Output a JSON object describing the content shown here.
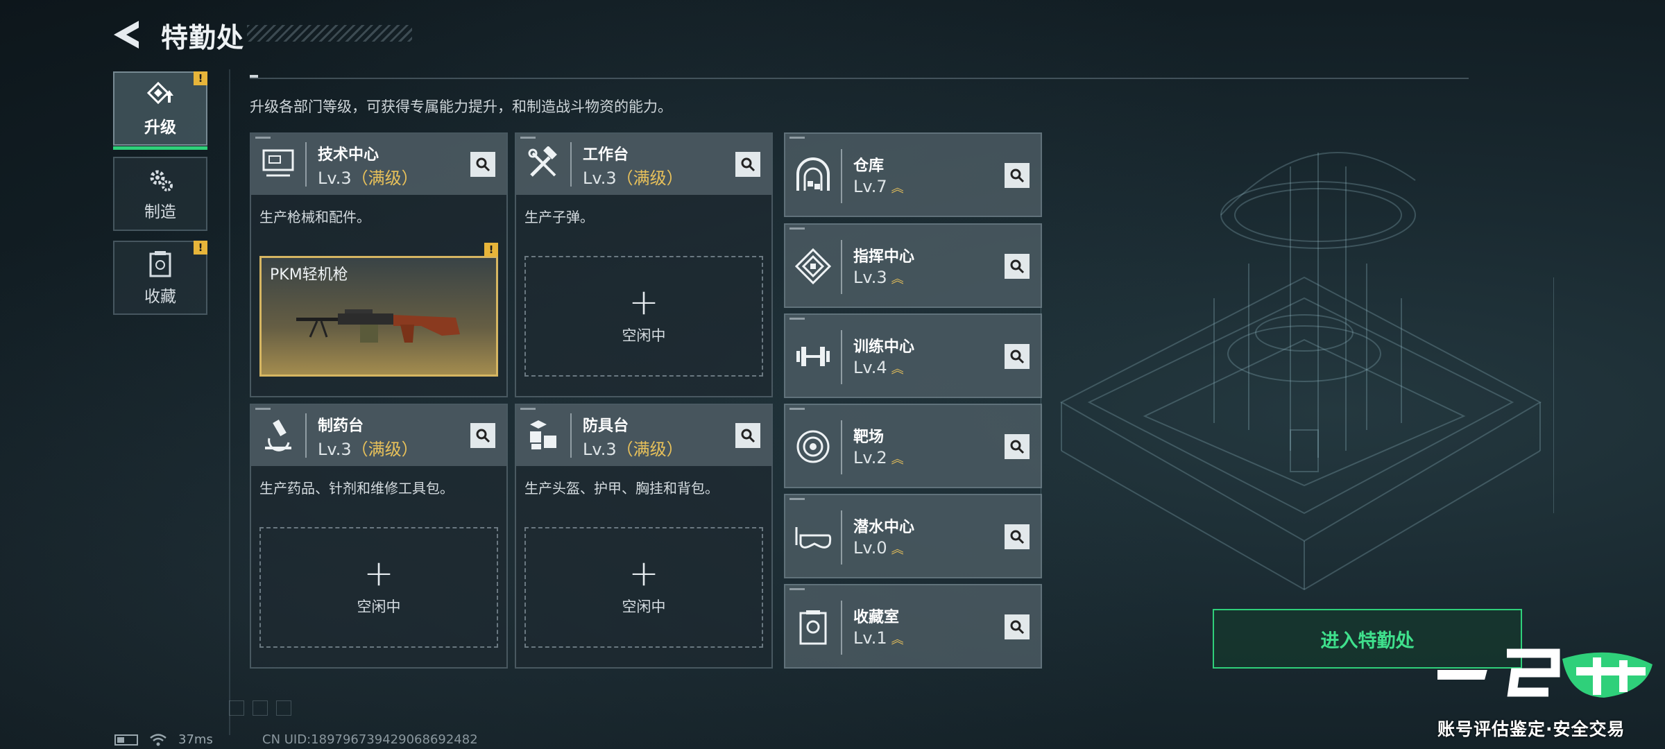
{
  "header": {
    "title": "特勤处"
  },
  "tabs": [
    {
      "label": "升级",
      "icon": "upgrade-icon",
      "active": true,
      "warning": "!"
    },
    {
      "label": "制造",
      "icon": "gears-icon",
      "active": false
    },
    {
      "label": "收藏",
      "icon": "collection-icon",
      "active": false,
      "warning": "!"
    }
  ],
  "description": "升级各部门等级，可获得专属能力提升，和制造战斗物资的能力。",
  "departments": [
    {
      "name": "技术中心",
      "level": "Lv.3",
      "max": "（满级）",
      "desc": "生产枪械和配件。",
      "slot": {
        "item": "PKM轻机枪",
        "warning": "!"
      }
    },
    {
      "name": "工作台",
      "level": "Lv.3",
      "max": "（满级）",
      "desc": "生产子弹。",
      "slot": {
        "plus": "+",
        "idle": "空闲中"
      }
    },
    {
      "name": "制药台",
      "level": "Lv.3",
      "max": "（满级）",
      "desc": "生产药品、针剂和维修工具包。",
      "slot": {
        "plus": "+",
        "idle": "空闲中"
      }
    },
    {
      "name": "防具台",
      "level": "Lv.3",
      "max": "（满级）",
      "desc": "生产头盔、护甲、胸挂和背包。",
      "slot": {
        "plus": "+",
        "idle": "空闲中"
      }
    }
  ],
  "facilities": [
    {
      "name": "仓库",
      "level": "Lv.7",
      "icon": "warehouse-icon"
    },
    {
      "name": "指挥中心",
      "level": "Lv.3",
      "icon": "command-center-icon"
    },
    {
      "name": "训练中心",
      "level": "Lv.4",
      "icon": "dumbbell-icon"
    },
    {
      "name": "靶场",
      "level": "Lv.2",
      "icon": "target-icon"
    },
    {
      "name": "潜水中心",
      "level": "Lv.0",
      "icon": "diving-mask-icon"
    },
    {
      "name": "收藏室",
      "level": "Lv.1",
      "icon": "collection-room-icon"
    }
  ],
  "upgrade_glyph": "︽",
  "enter_button": "进入特勤处",
  "status": {
    "ping": "37ms",
    "uid": "CN UID:1897967394290686924​82"
  },
  "watermark": {
    "tagline": "账号评估鉴定·安全交易"
  },
  "colors": {
    "accent_green": "#2fd07a",
    "max_gold": "#e8c15a",
    "warning": "#e7b53a"
  }
}
